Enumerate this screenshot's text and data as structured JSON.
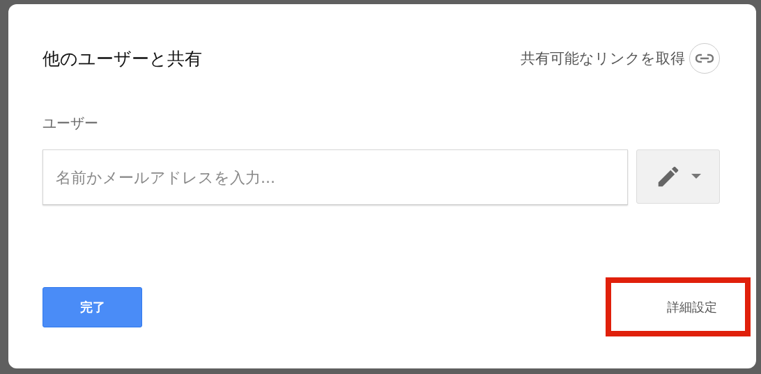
{
  "dialog": {
    "title": "他のユーザーと共有",
    "share_link": "共有可能なリンクを取得",
    "people_label": "ユーザー",
    "input": {
      "placeholder": "名前かメールアドレスを入力..."
    },
    "done_button": "完了",
    "advanced": {
      "label": "詳細設定",
      "highlighted": true
    }
  }
}
